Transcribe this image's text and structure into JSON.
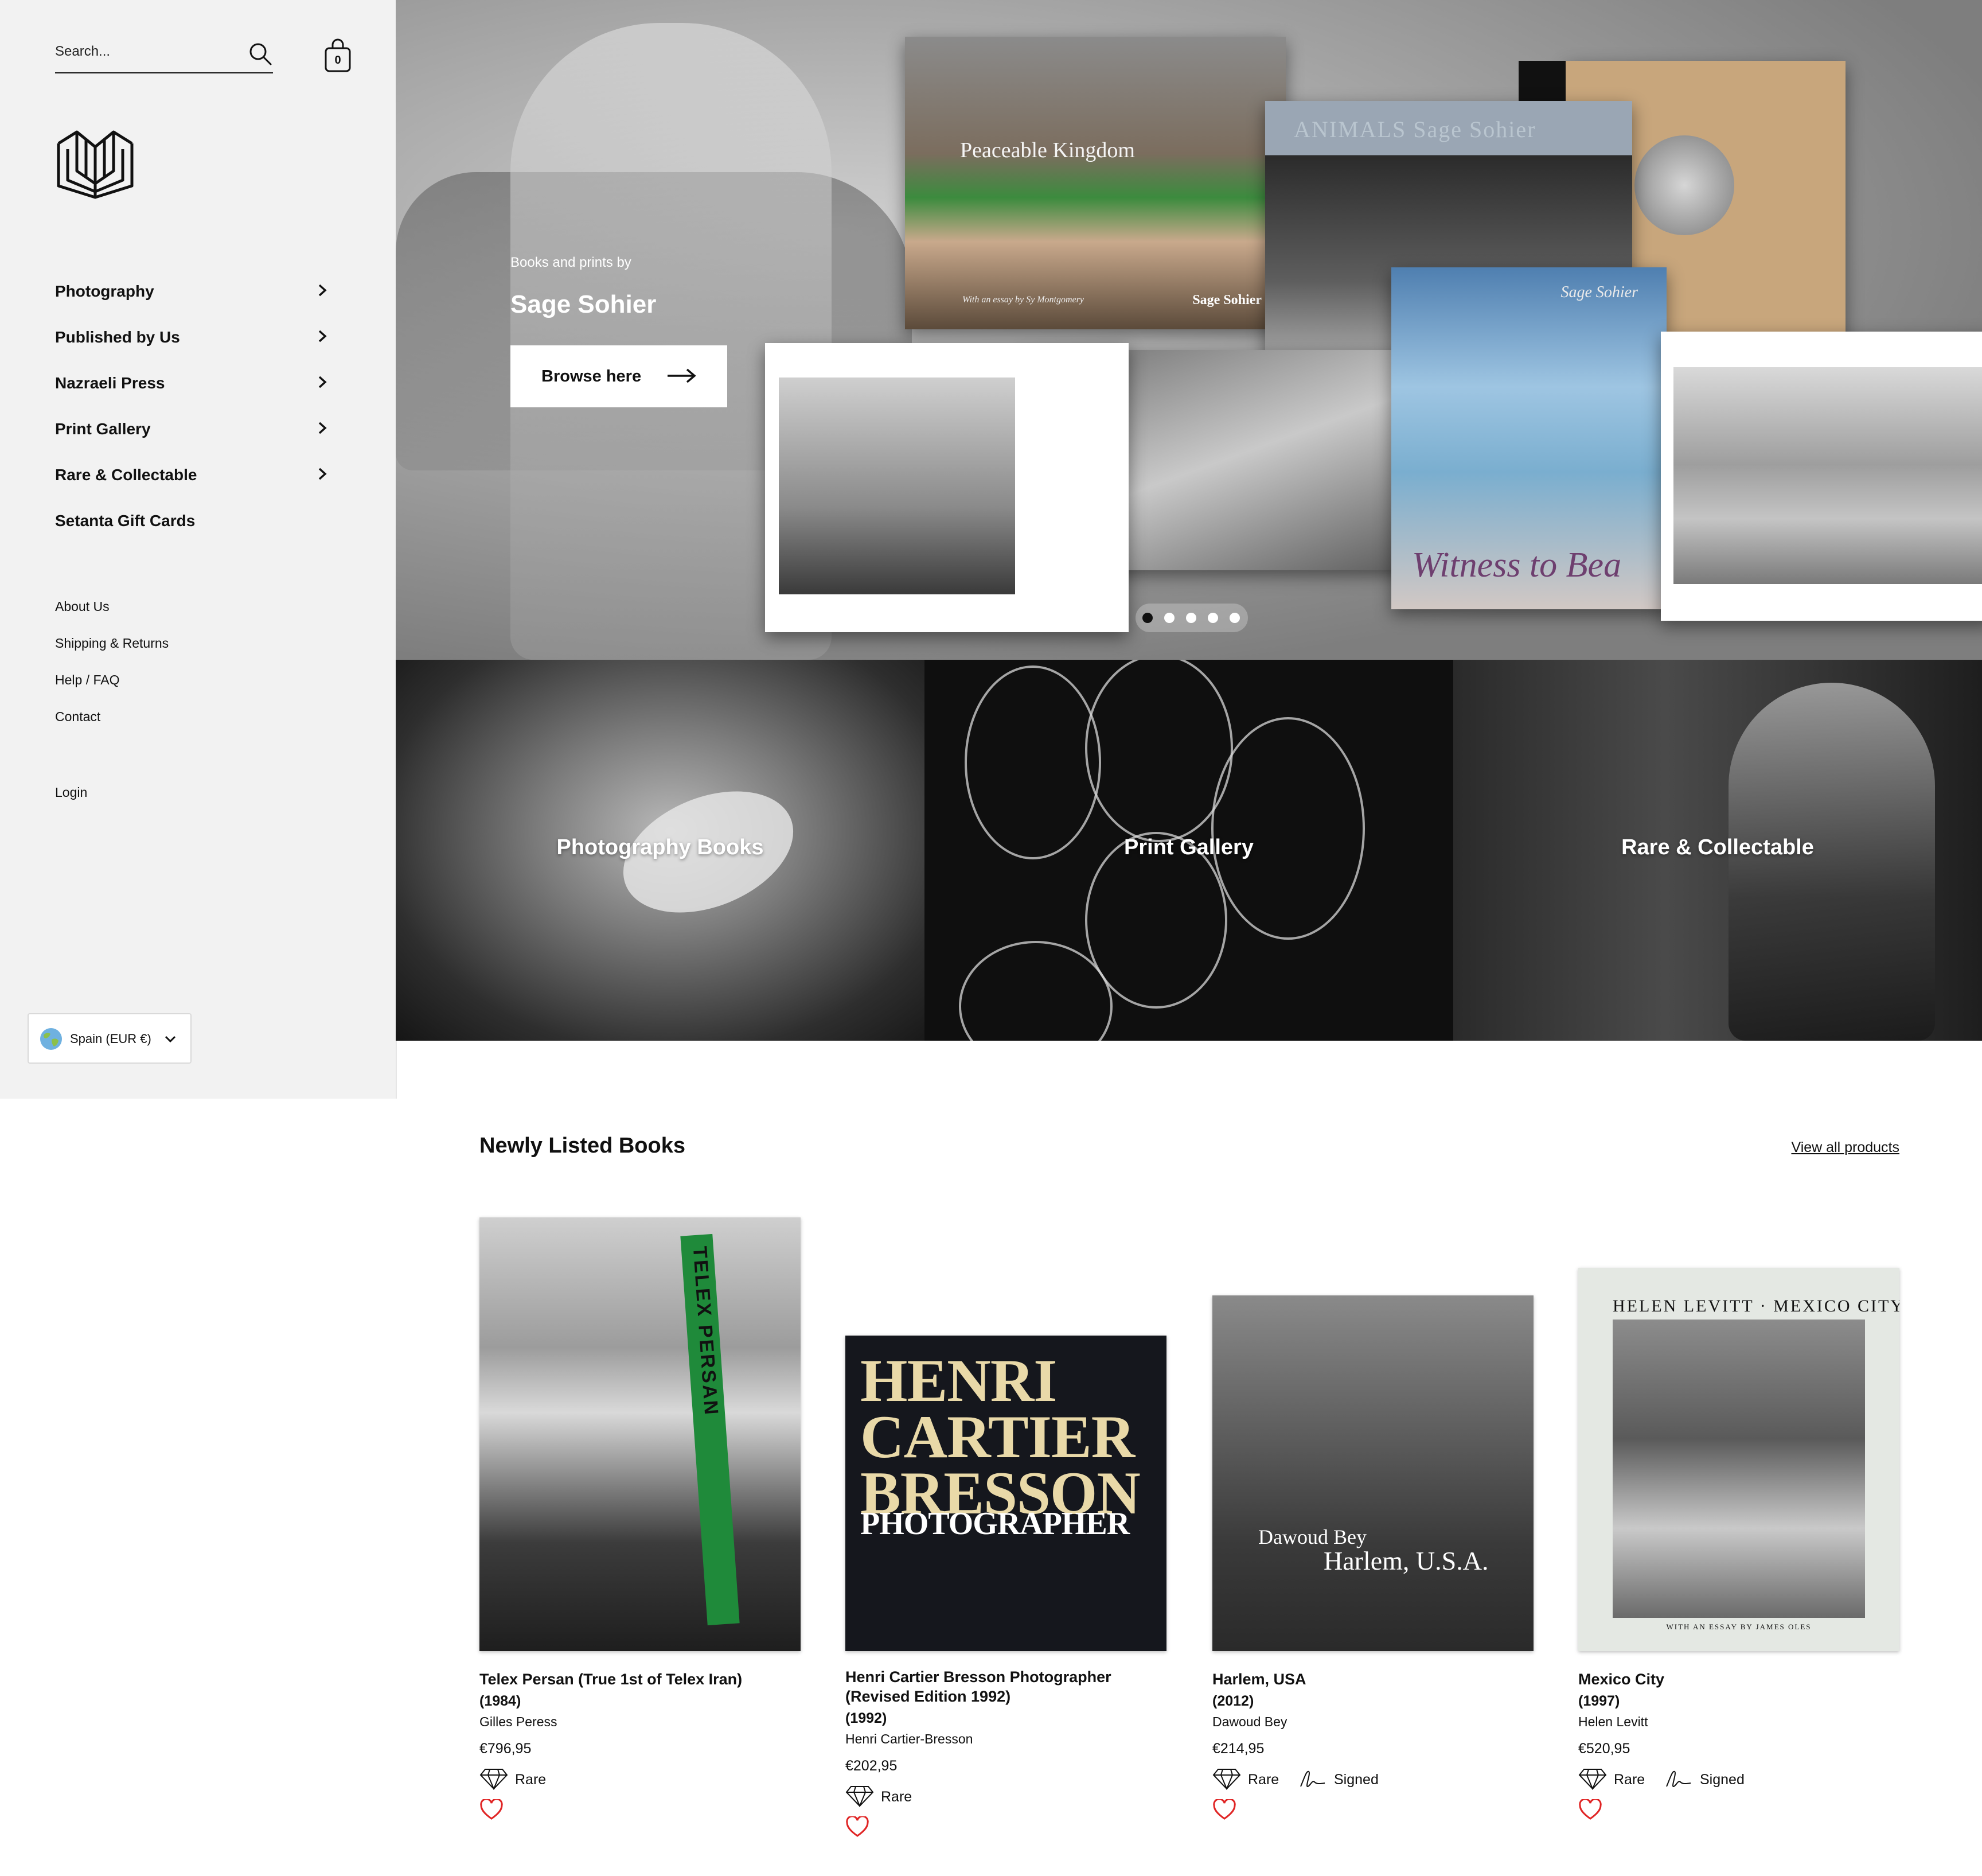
{
  "sidebar": {
    "search": {
      "placeholder": "Search...",
      "icon": "search-icon"
    },
    "cart": {
      "count": "0",
      "icon": "shopping-bag-icon"
    },
    "logo": {
      "icon": "open-book-logo-icon"
    },
    "main_nav": [
      {
        "label": "Photography",
        "has_submenu": true
      },
      {
        "label": "Published by Us",
        "has_submenu": true
      },
      {
        "label": "Nazraeli Press",
        "has_submenu": true
      },
      {
        "label": "Print Gallery",
        "has_submenu": true
      },
      {
        "label": "Rare & Collectable",
        "has_submenu": true
      },
      {
        "label": "Setanta Gift Cards",
        "has_submenu": false
      }
    ],
    "secondary_nav": [
      {
        "label": "About Us"
      },
      {
        "label": "Shipping & Returns"
      },
      {
        "label": "Help / FAQ"
      },
      {
        "label": "Contact"
      }
    ],
    "login": "Login",
    "country": {
      "label": "Spain (EUR €)",
      "icon": "globe-icon"
    }
  },
  "hero": {
    "kicker": "Books and prints by",
    "title": "Sage Sohier",
    "cta": "Browse here",
    "slide_count": 5,
    "active_slide": 0,
    "artwork": {
      "peaceable_title": "Peaceable Kingdom",
      "peaceable_subtitle": "With an essay by Sy Montgomery",
      "peaceable_author": "Sage Sohier",
      "animals_title": "ANIMALS    Sage Sohier",
      "witness_title": "Witness to Bea",
      "witness_author": "Sage Sohier"
    }
  },
  "collections": [
    {
      "label": "Photography Books"
    },
    {
      "label": "Print Gallery"
    },
    {
      "label": "Rare & Collectable"
    }
  ],
  "products_section": {
    "title": "Newly Listed Books",
    "view_all": "View all products",
    "items": [
      {
        "title": "Telex Persan (True 1st of Telex Iran)",
        "year": "(1984)",
        "author": "Gilles Peress",
        "price": "€796,95",
        "badges": [
          {
            "label": "Rare",
            "icon": "diamond-icon"
          }
        ],
        "cover_text": "TELEX PERSAN"
      },
      {
        "title": "Henri Cartier Bresson Photographer (Revised Edition 1992)",
        "year": "(1992)",
        "author": "Henri Cartier-Bresson",
        "price": "€202,95",
        "badges": [
          {
            "label": "Rare",
            "icon": "diamond-icon"
          }
        ],
        "cover_text": "HENRI CARTIER BRESSON",
        "cover_subtext": "PHOTOGRAPHER"
      },
      {
        "title": "Harlem, USA",
        "year": "(2012)",
        "author": "Dawoud Bey",
        "price": "€214,95",
        "badges": [
          {
            "label": "Rare",
            "icon": "diamond-icon"
          },
          {
            "label": "Signed",
            "icon": "signature-icon"
          }
        ],
        "cover_author": "Dawoud Bey",
        "cover_text": "Harlem, U.S.A."
      },
      {
        "title": "Mexico City",
        "year": "(1997)",
        "author": "Helen Levitt",
        "price": "€520,95",
        "badges": [
          {
            "label": "Rare",
            "icon": "diamond-icon"
          },
          {
            "label": "Signed",
            "icon": "signature-icon"
          }
        ],
        "cover_text": "HELEN LEVITT · MEXICO CITY",
        "cover_subtext": "WITH AN ESSAY BY JAMES OLES"
      }
    ]
  },
  "colors": {
    "sidebar_bg": "#f2f2f2",
    "telex_band": "#1f8a3a",
    "heart": "#e02424",
    "hcb_title": "#e9d9a8"
  }
}
